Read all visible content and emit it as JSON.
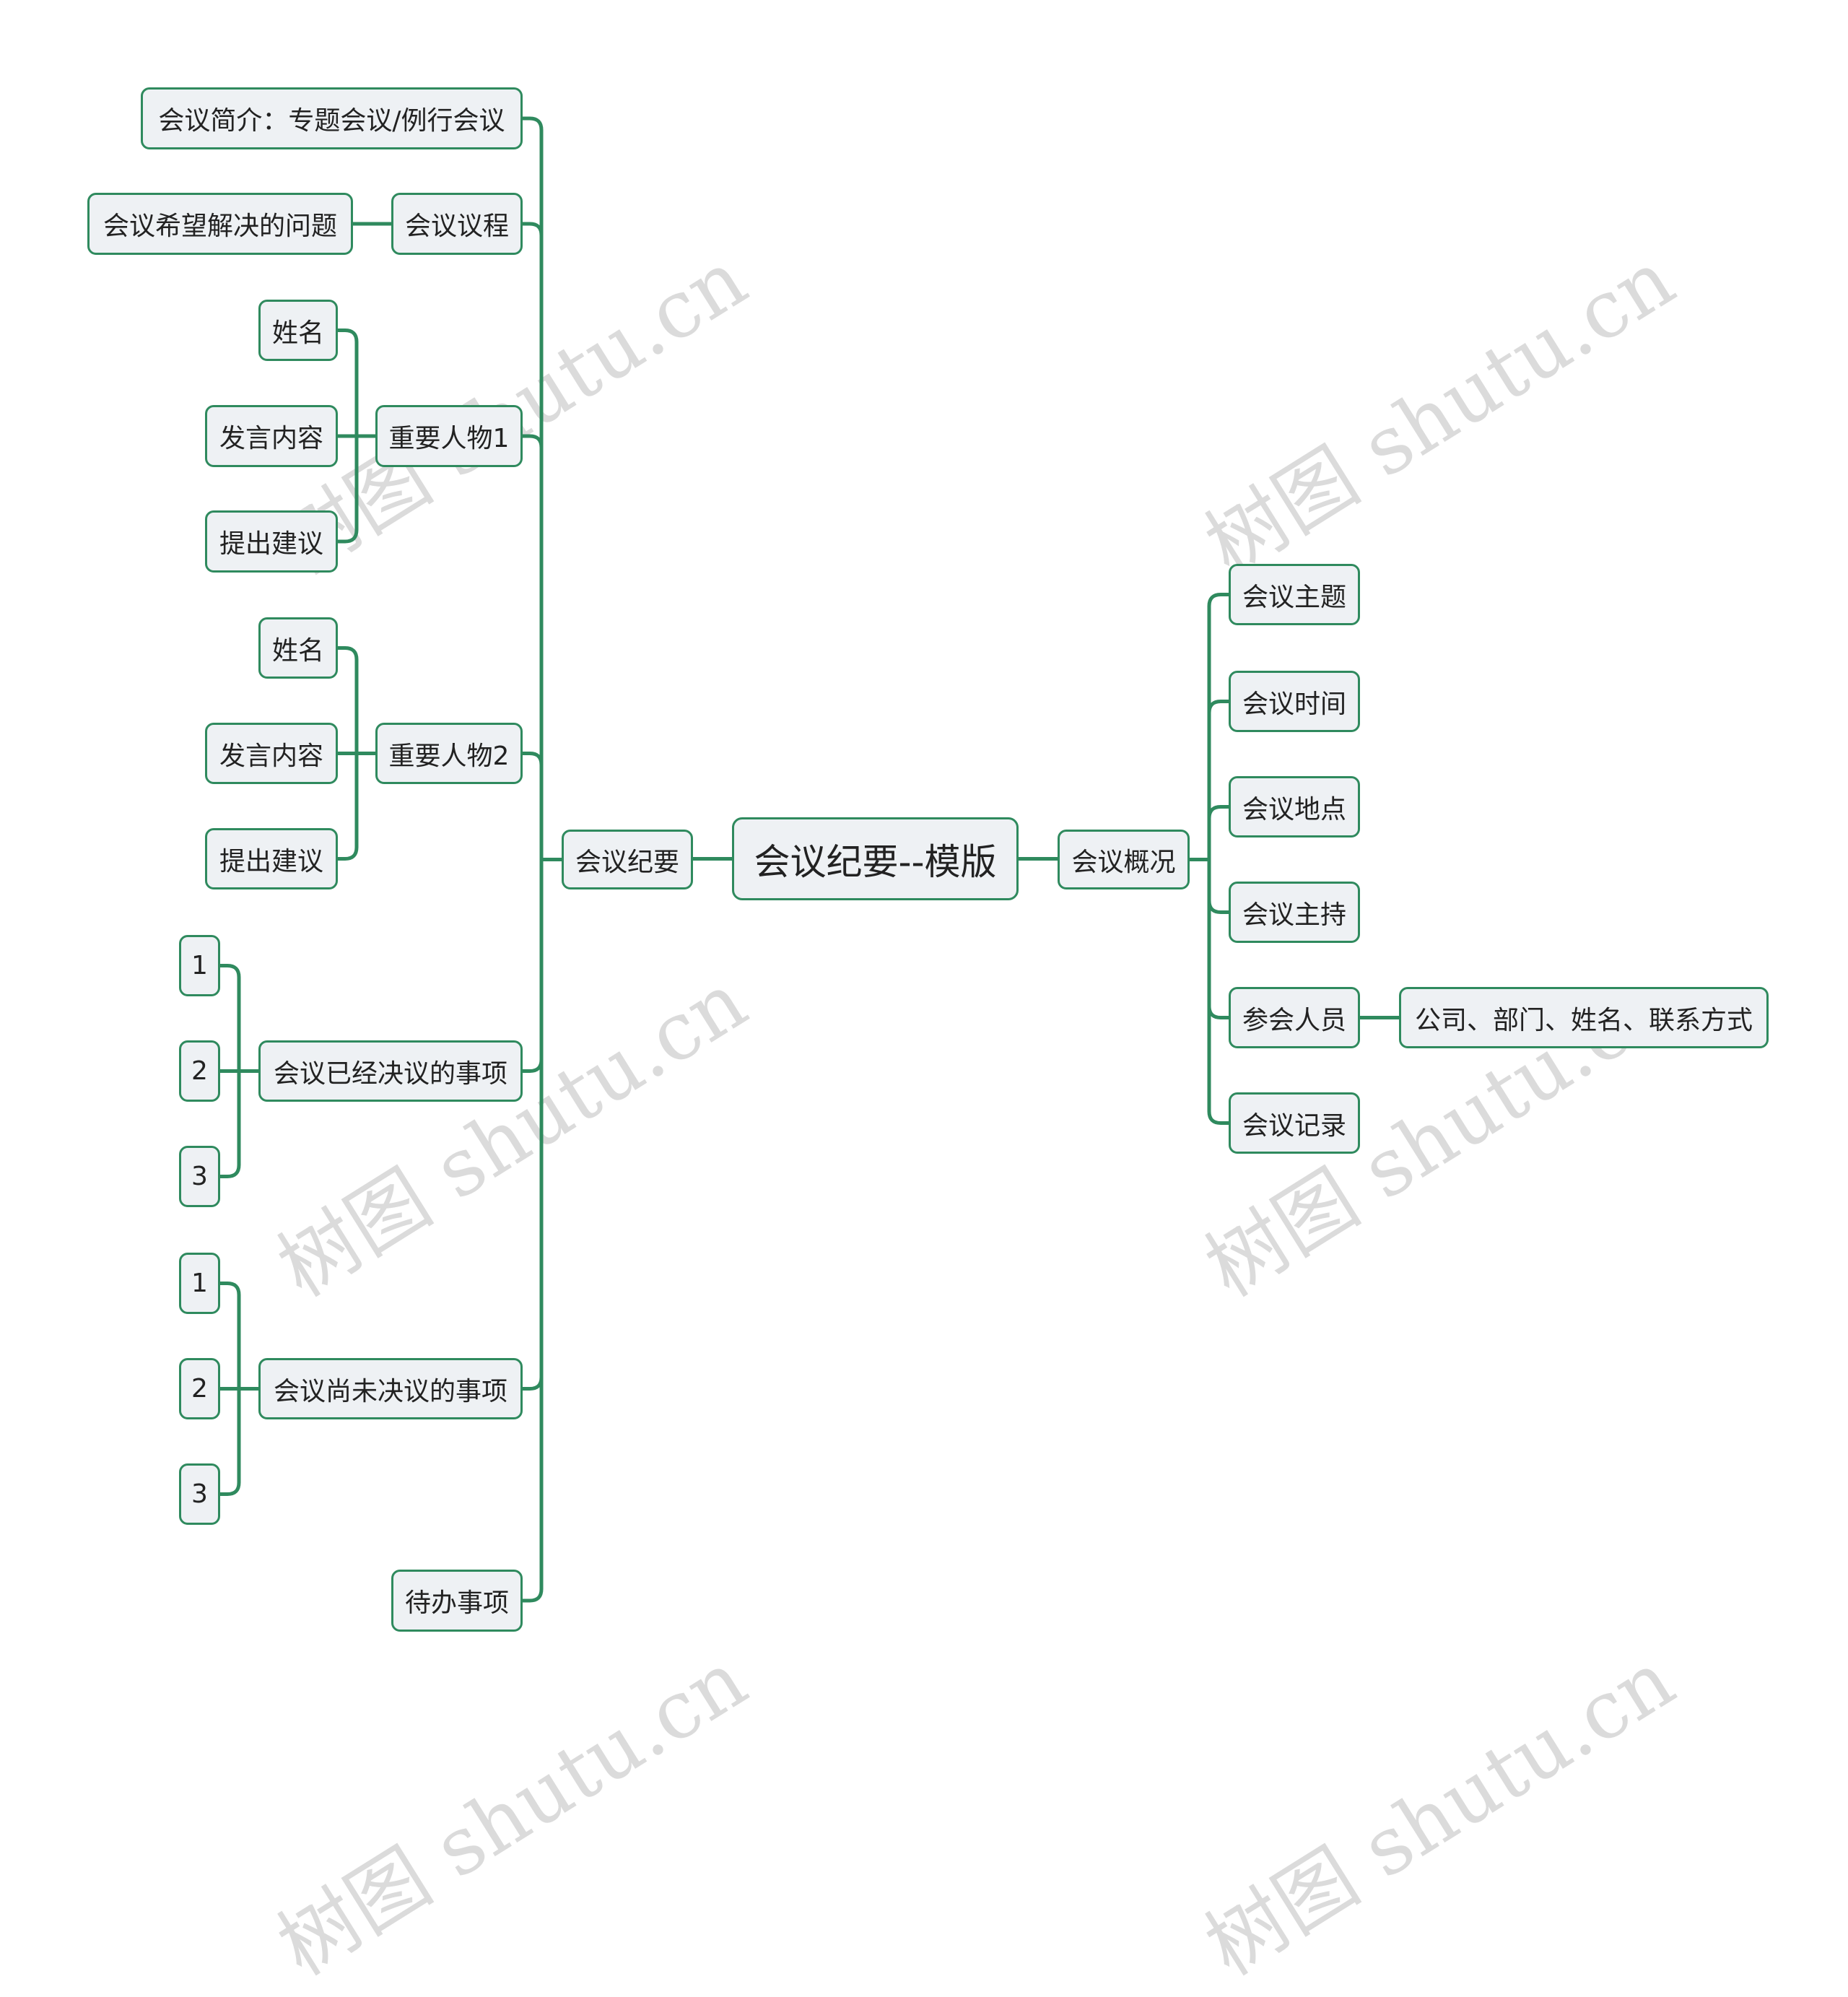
{
  "root": "会议纪要--模版",
  "left": {
    "label": "会议纪要",
    "children": [
      {
        "label": "会议简介：专题会议/例行会议"
      },
      {
        "label": "会议议程",
        "children": [
          "会议希望解决的问题"
        ]
      },
      {
        "label": "重要人物1",
        "children": [
          "姓名",
          "发言内容",
          "提出建议"
        ]
      },
      {
        "label": "重要人物2",
        "children": [
          "姓名",
          "发言内容",
          "提出建议"
        ]
      },
      {
        "label": "会议已经决议的事项",
        "children": [
          "1",
          "2",
          "3"
        ]
      },
      {
        "label": "会议尚未决议的事项",
        "children": [
          "1",
          "2",
          "3"
        ]
      },
      {
        "label": "待办事项"
      }
    ]
  },
  "right": {
    "label": "会议概况",
    "children": [
      {
        "label": "会议主题"
      },
      {
        "label": "会议时间"
      },
      {
        "label": "会议地点"
      },
      {
        "label": "会议主持"
      },
      {
        "label": "参会人员",
        "children": [
          "公司、部门、姓名、联系方式"
        ]
      },
      {
        "label": "会议记录"
      }
    ]
  },
  "watermark": "树图 shutu.cn",
  "colors": {
    "line": "#2f8a5e",
    "node_bg": "#eef1f4",
    "node_border": "#2f8a5e"
  }
}
